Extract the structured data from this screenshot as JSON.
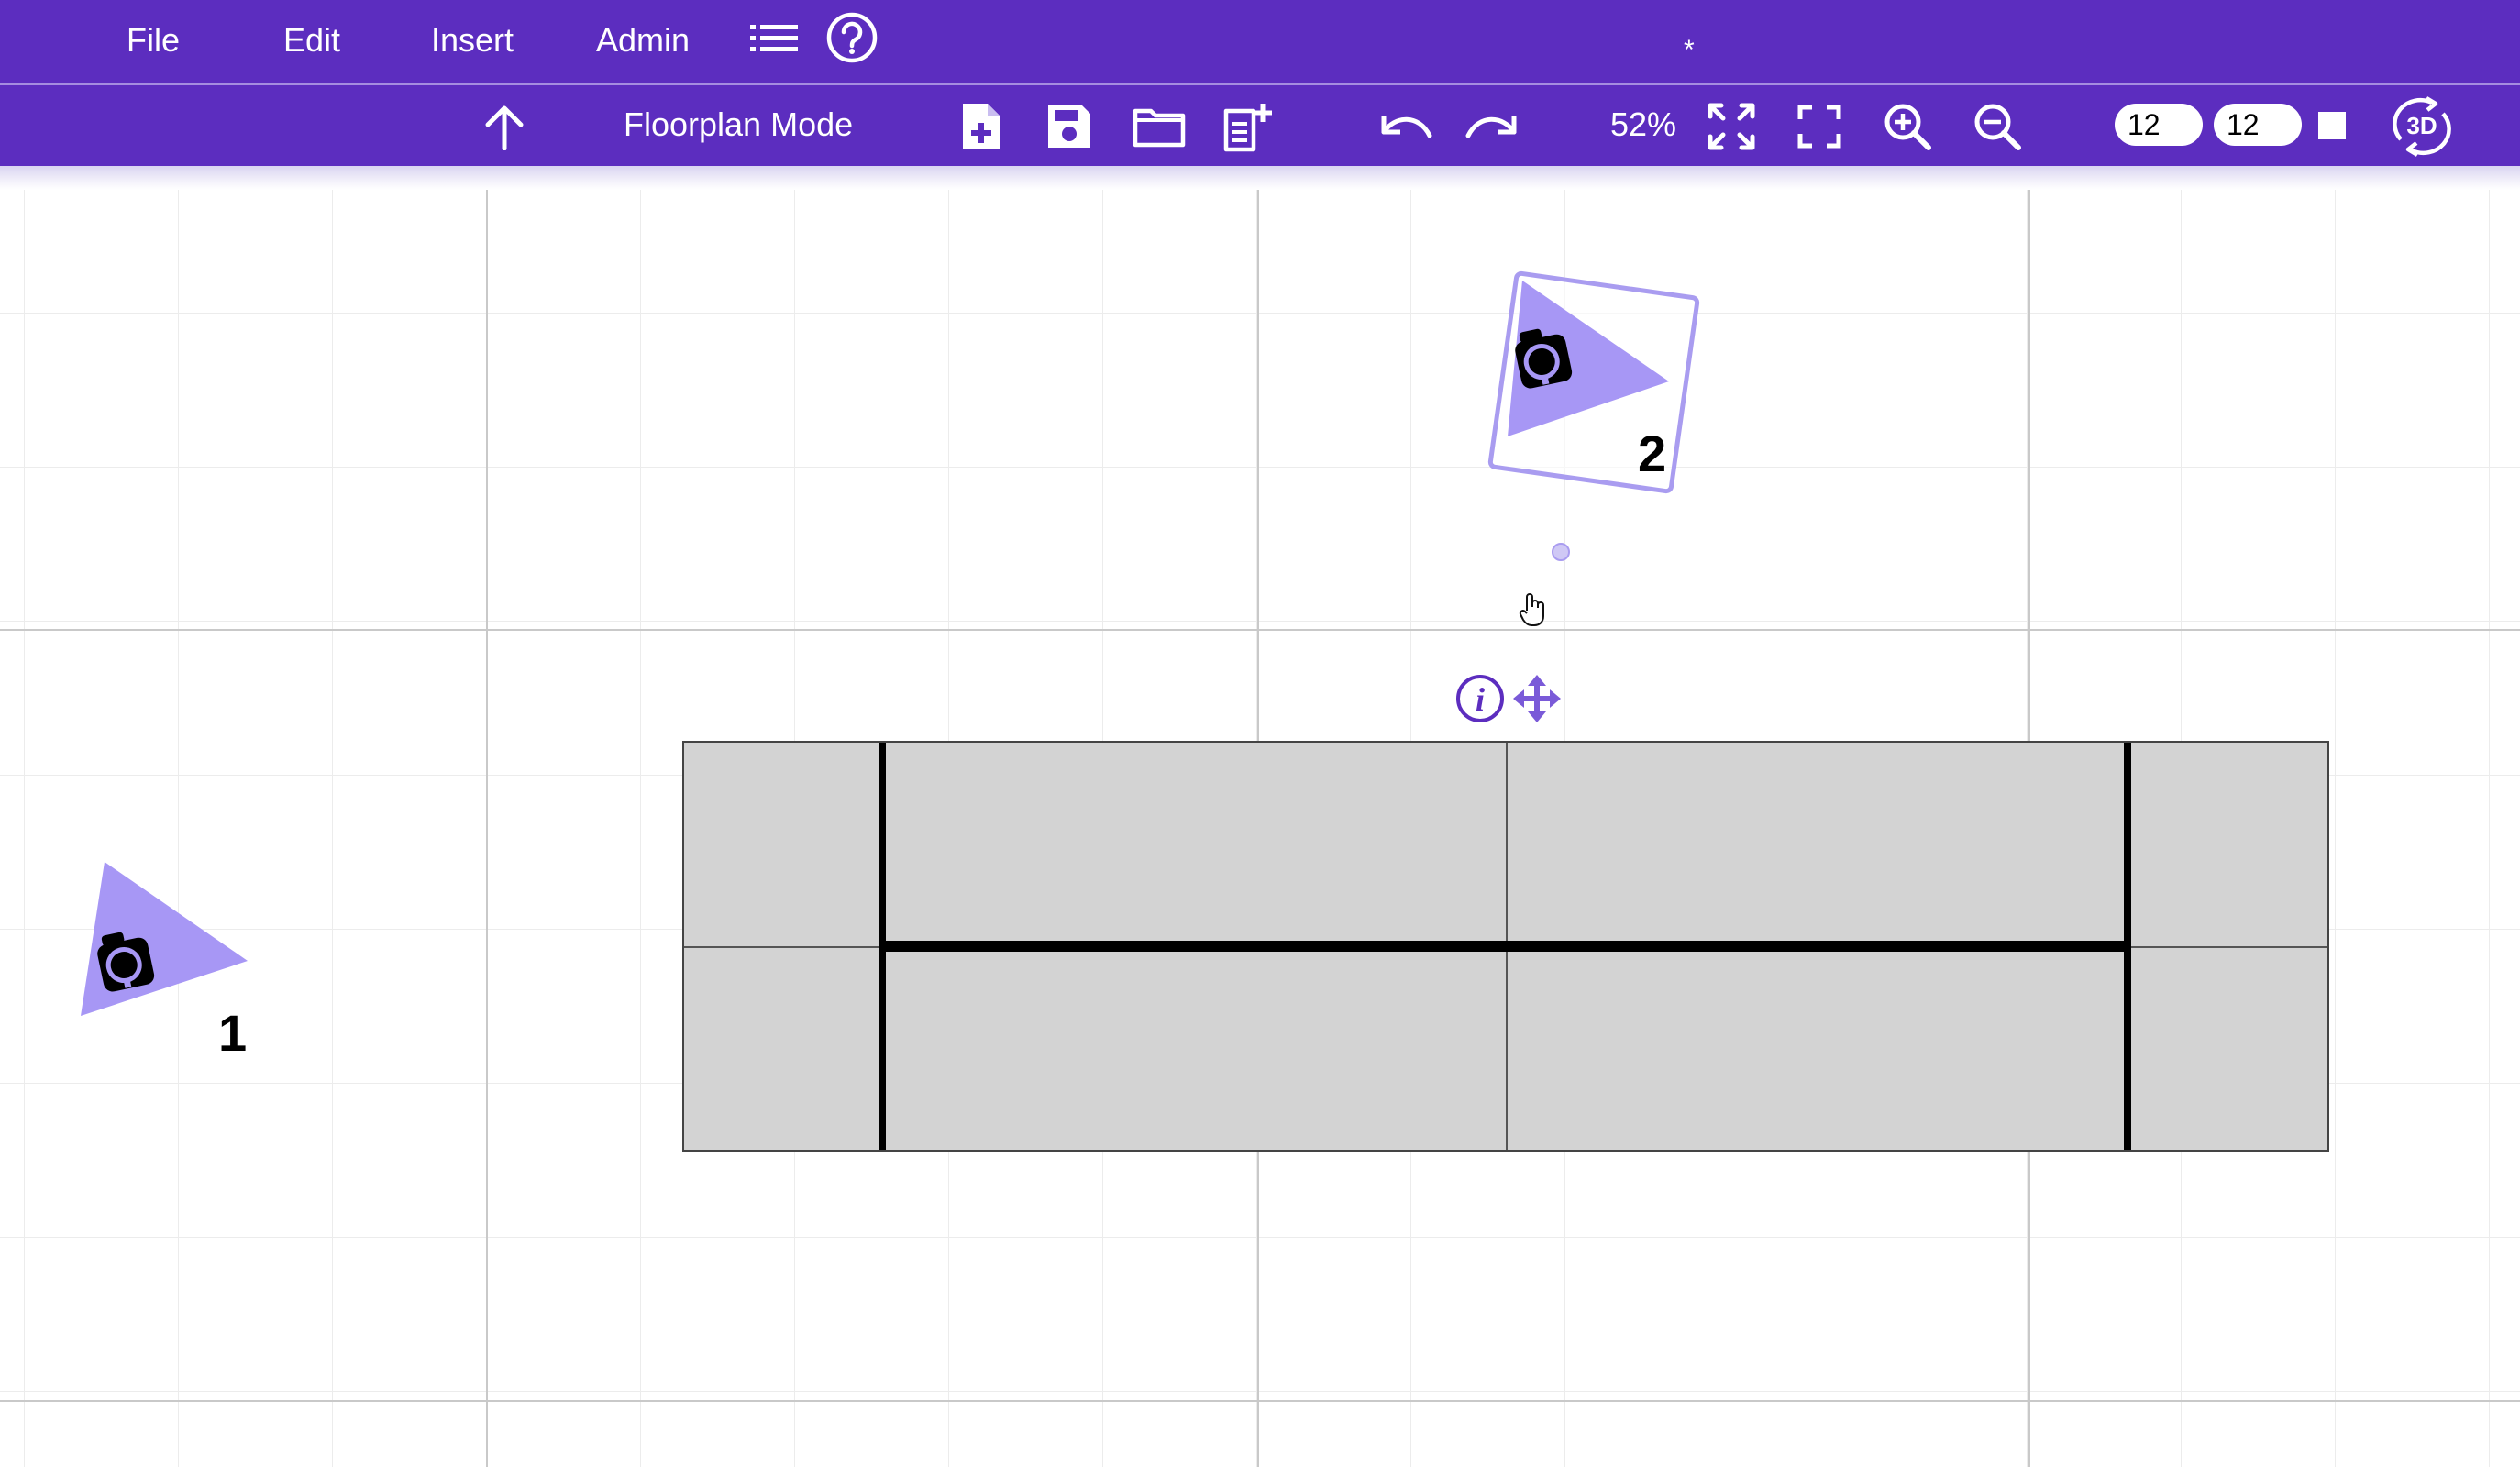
{
  "menubar": {
    "items": [
      {
        "label": "File"
      },
      {
        "label": "Edit"
      },
      {
        "label": "Insert"
      },
      {
        "label": "Admin"
      }
    ],
    "icons": [
      "list-icon",
      "help-circle-icon"
    ],
    "unsaved_marker": "*"
  },
  "toolbar": {
    "mode_label": "Floorplan Mode",
    "zoom_level": "52%",
    "grid_x_value": "12",
    "grid_y_value": "12",
    "icons": [
      "arrow-up-icon",
      "new-file-icon",
      "save-icon",
      "open-folder-icon",
      "add-page-icon",
      "undo-icon",
      "redo-icon",
      "fit-to-screen-icon",
      "fullscreen-icon",
      "zoom-in-icon",
      "zoom-out-icon",
      "stop-square-icon",
      "rotate-3d-icon"
    ],
    "rotate_3d_label": "3D"
  },
  "canvas": {
    "cameras": [
      {
        "number": "1",
        "selected": false
      },
      {
        "number": "2",
        "selected": true
      }
    ],
    "colors": {
      "accent": "#5c2dbf",
      "camera_fill": "#a797f5",
      "selection": "#a99cf0",
      "floor": "#d3d3d3"
    }
  },
  "floating_tools": {
    "info_icon": "info-icon",
    "move_icon": "move-arrows-icon",
    "info_glyph": "i"
  }
}
